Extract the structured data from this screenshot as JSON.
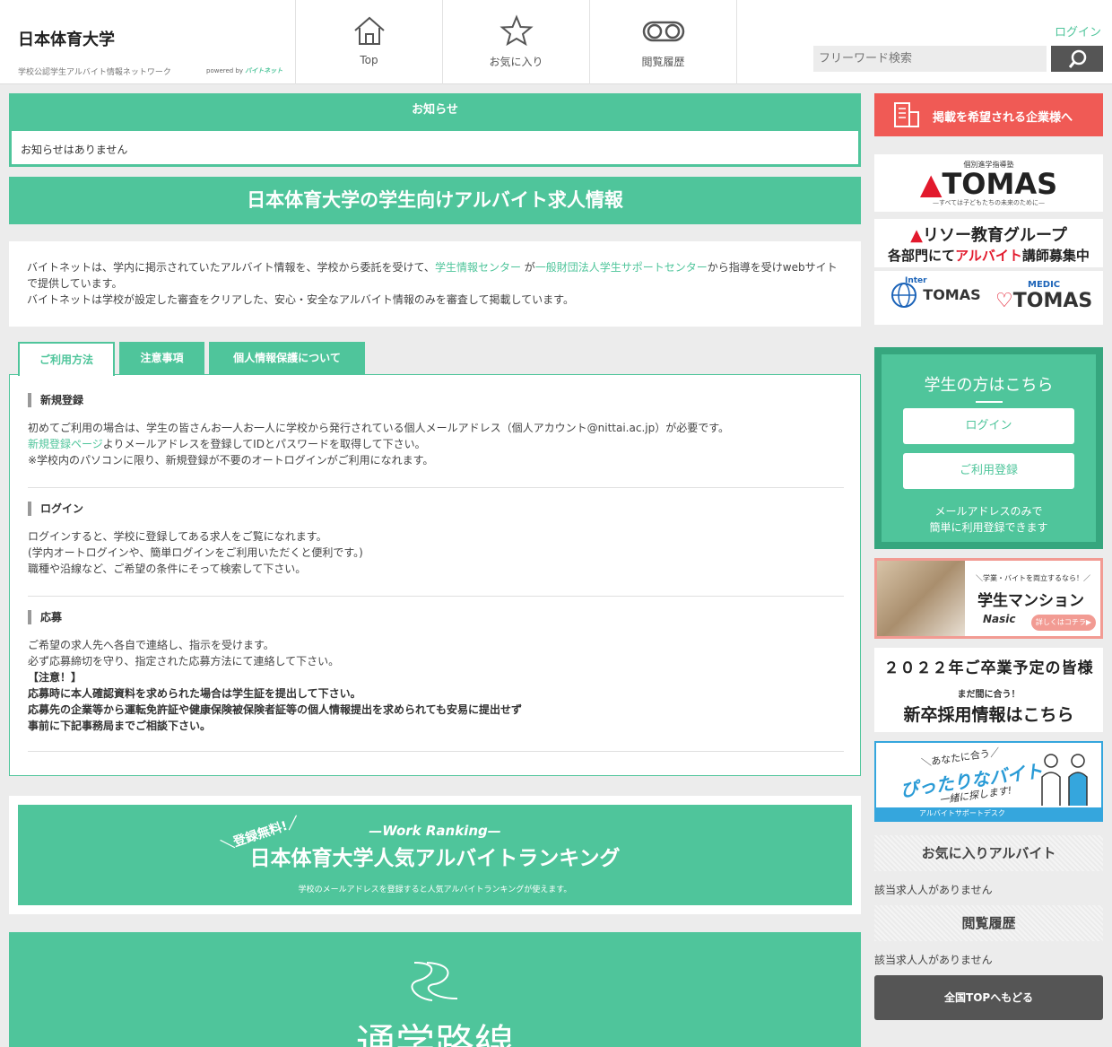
{
  "header": {
    "brand_title": "日本体育大学",
    "brand_sub": "学校公認学生アルバイト情報ネットワーク",
    "powered_prefix": "powered by",
    "powered_brand": "バイトネット",
    "nav": [
      {
        "label": "Top",
        "icon": "home-icon"
      },
      {
        "label": "お気に入り",
        "icon": "star-icon"
      },
      {
        "label": "閲覧履歴",
        "icon": "glasses-icon"
      }
    ],
    "login": "ログイン",
    "search_placeholder": "フリーワード検索"
  },
  "notice": {
    "title": "お知らせ",
    "body": "お知らせはありません"
  },
  "main_title": "日本体育大学の学生向けアルバイト求人情報",
  "intro": {
    "line1_a": "バイトネットは、学内に掲示されていたアルバイト情報を、学校から委託を受けて、",
    "link1": "学生情報センター",
    "line1_b": " が",
    "link2": "一般財団法人学生サポートセンター",
    "line1_c": "から指導を受けwebサイトで提供しています。",
    "line2": "バイトネットは学校が設定した審査をクリアした、安心・安全なアルバイト情報のみを審査して掲載しています。"
  },
  "tabs": [
    "ご利用方法",
    "注意事項",
    "個人情報保護について"
  ],
  "sections": {
    "register": {
      "head": "新規登録",
      "l1": "初めてご利用の場合は、学生の皆さんお一人お一人に学校から発行されている個人メールアドレス（個人アカウント@nittai.ac.jp）が必要です。",
      "l2_link": "新規登録ページ",
      "l2_rest": "よりメールアドレスを登録してIDとパスワードを取得して下さい。",
      "l3": "※学校内のパソコンに限り、新規登録が不要のオートログインがご利用になれます。"
    },
    "login": {
      "head": "ログイン",
      "l1": "ログインすると、学校に登録してある求人をご覧になれます。",
      "l2": "(学内オートログインや、簡単ログインをご利用いただくと便利です。)",
      "l3": "職種や沿線など、ご希望の条件にそって検索して下さい。"
    },
    "apply": {
      "head": "応募",
      "l1": "ご希望の求人先へ各自で連絡し、指示を受けます。",
      "l2": "必ず応募締切を守り、指定された応募方法にて連絡して下さい。",
      "l3": "【注意！】",
      "l4": "応募時に本人確認資料を求められた場合は学生証を提出して下さい。",
      "l5": "応募先の企業等から運転免許証や健康保険被保険者証等の個人情報提出を求められても安易に提出せず",
      "l6": "事前に下記事務局までご相談下さい。"
    }
  },
  "ranking": {
    "en": "—Work Ranking—",
    "free": "＼登録無料!／",
    "title": "日本体育大学人気アルバイトランキング",
    "sub": "学校のメールアドレスを登録すると人気アルバイトランキングが使えます。"
  },
  "route_title": "通学路線",
  "sidebar": {
    "ad_button": "掲載を希望される企業様へ",
    "tomas_small": "個別進学指導塾",
    "tomas_logo": "TOMAS",
    "tomas_tag": "—すべては子どもたちの未来のために—",
    "riso_name_a": "リソー",
    "riso_name_b": "教育グループ",
    "riso_sub_a": "各部門にて",
    "riso_sub_b": "アルバイト",
    "riso_sub_c": "講師募集中",
    "inter_tomas": "TOMAS",
    "inter_tag": "Inter",
    "medic_small": "MEDIC",
    "medic_logo": "TOMAS",
    "student_title": "学生の方はこちら",
    "student_login": "ログイン",
    "student_register": "ご利用登録",
    "student_note1": "メールアドレスのみで",
    "student_note2": "簡単に利用登録できます",
    "mansion_small": "＼学業・バイトを両立するなら！／",
    "mansion_title": "学生マンション",
    "mansion_logo": "Nasic",
    "mansion_btn": "詳しくはコチラ▶",
    "grad_1": "２０２２年ご卒業予定の皆様",
    "grad_2": "まだ間に合う！",
    "grad_3": "新卒採用情報はこちら",
    "baito_small": "＼あなたに合う／",
    "baito_main": "ぴったりなバイト",
    "baito_small2": "一緒に探します!",
    "baito_bar": "アルバイトサポートデスク",
    "fav_head": "お気に入りアルバイト",
    "fav_empty": "該当求人人がありません",
    "hist_head": "閲覧履歴",
    "hist_empty": "該当求人人がありません",
    "back_button": "全国TOPへもどる"
  }
}
